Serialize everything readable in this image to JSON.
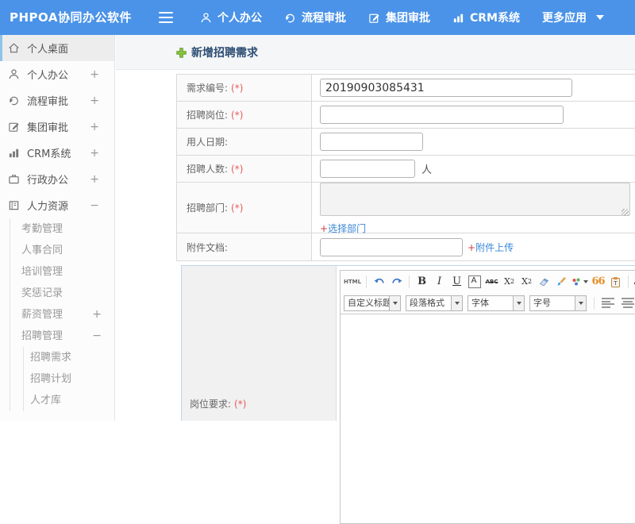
{
  "topbar": {
    "brand": "PHPOA协同办公软件",
    "nav": [
      {
        "label": "个人办公"
      },
      {
        "label": "流程审批"
      },
      {
        "label": "集团审批"
      },
      {
        "label": "CRM系统"
      },
      {
        "label": "更多应用"
      }
    ]
  },
  "sidebar": {
    "items": [
      {
        "label": "个人桌面"
      },
      {
        "label": "个人办公",
        "toggle": "+"
      },
      {
        "label": "流程审批",
        "toggle": "+"
      },
      {
        "label": "集团审批",
        "toggle": "+"
      },
      {
        "label": "CRM系统",
        "toggle": "+"
      },
      {
        "label": "行政办公",
        "toggle": "+"
      },
      {
        "label": "人力资源",
        "toggle": "−"
      }
    ],
    "hr_children": [
      {
        "label": "考勤管理"
      },
      {
        "label": "人事合同"
      },
      {
        "label": "培训管理"
      },
      {
        "label": "奖惩记录"
      },
      {
        "label": "薪资管理",
        "toggle": "+"
      },
      {
        "label": "招聘管理",
        "toggle": "−"
      }
    ],
    "recruit_children": [
      {
        "label": "招聘需求"
      },
      {
        "label": "招聘计划"
      },
      {
        "label": "人才库"
      }
    ]
  },
  "page": {
    "title": "新增招聘需求"
  },
  "form": {
    "rows": [
      {
        "label": "需求编号:",
        "required": "(*)",
        "value": "20190903085431"
      },
      {
        "label": "招聘岗位:",
        "required": "(*)",
        "value": ""
      },
      {
        "label": "用人日期:",
        "value": ""
      },
      {
        "label": "招聘人数:",
        "required": "(*)",
        "value": "",
        "suffix": "人"
      },
      {
        "label": "招聘部门:",
        "required": "(*)",
        "link_plus": "+",
        "link_text": "选择部门"
      },
      {
        "label": "附件文档:",
        "value": "",
        "link_plus": "+",
        "link_text": "附件上传"
      },
      {
        "label": "岗位要求:",
        "required": "(*)"
      }
    ],
    "editor": {
      "html_label": "HTML",
      "bold": "B",
      "italic": "I",
      "underline": "U",
      "boxed_a": "A",
      "strike": "ABC",
      "sup_base": "X",
      "sup_exp": "2",
      "sub_base": "X",
      "sub_exp": "2",
      "quote": "66",
      "font_color": "A",
      "highlight": "ab",
      "dropdowns": [
        {
          "label": "自定义标题"
        },
        {
          "label": "段落格式"
        },
        {
          "label": "字体"
        },
        {
          "label": "字号"
        }
      ]
    }
  }
}
